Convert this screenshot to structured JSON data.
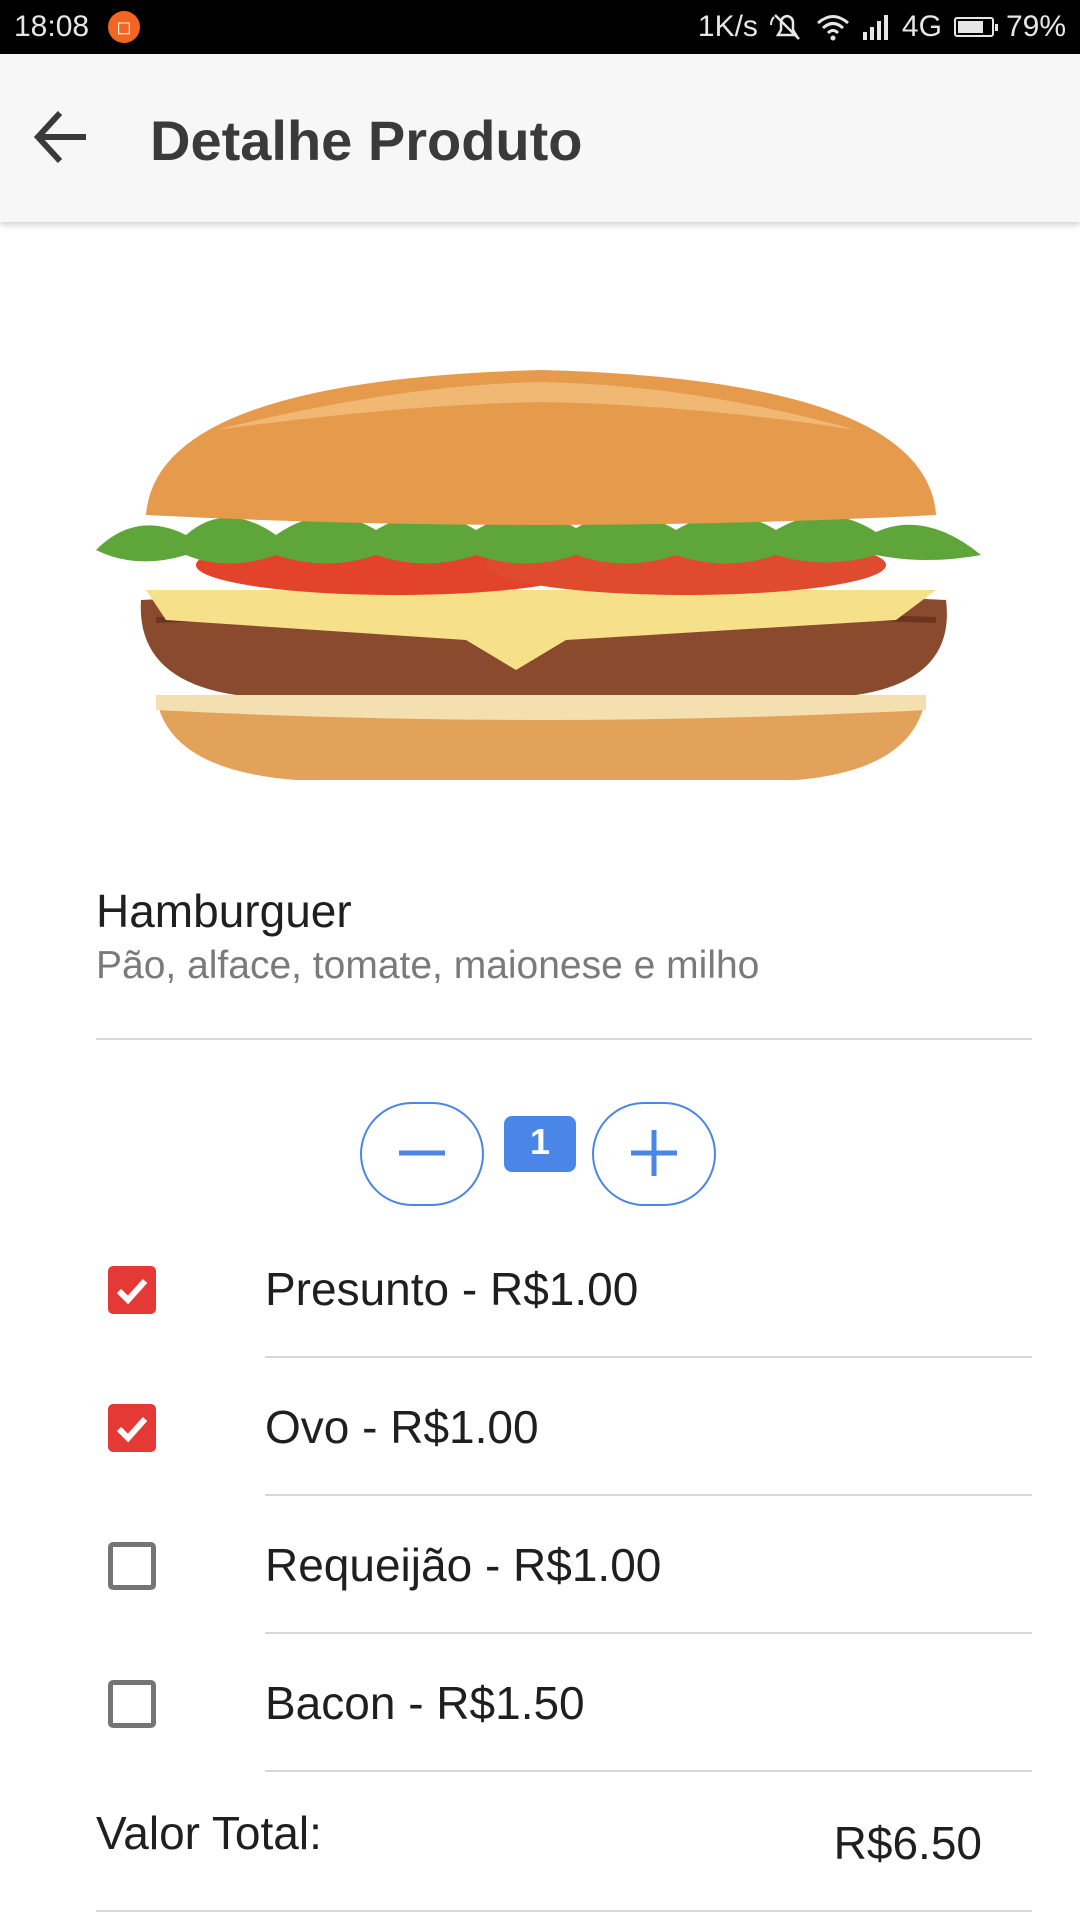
{
  "status_bar": {
    "time": "18:08",
    "notification_icon": "app-notification-icon",
    "net_speed": "1K/s",
    "network": "4G",
    "battery_level": 0.79,
    "battery_text": "79%"
  },
  "app_bar": {
    "title": "Detalhe Produto",
    "back_icon": "arrow-back-icon"
  },
  "product": {
    "name": "Hamburguer",
    "description": "Pão, alface, tomate, maionese e milho"
  },
  "quantity": {
    "value": "1",
    "decrement_icon": "minus-icon",
    "increment_icon": "plus-icon"
  },
  "options": [
    {
      "label": "Presunto - R$1.00",
      "checked": true
    },
    {
      "label": "Ovo - R$1.00",
      "checked": true
    },
    {
      "label": "Requeijão - R$1.00",
      "checked": false
    },
    {
      "label": "Bacon - R$1.50",
      "checked": false
    }
  ],
  "total": {
    "label": "Valor Total:",
    "value": "R$6.50"
  },
  "colors": {
    "accent_blue": "#4a86e8",
    "checkbox_red": "#e53935",
    "app_bar_bg": "#f7f7f7"
  }
}
